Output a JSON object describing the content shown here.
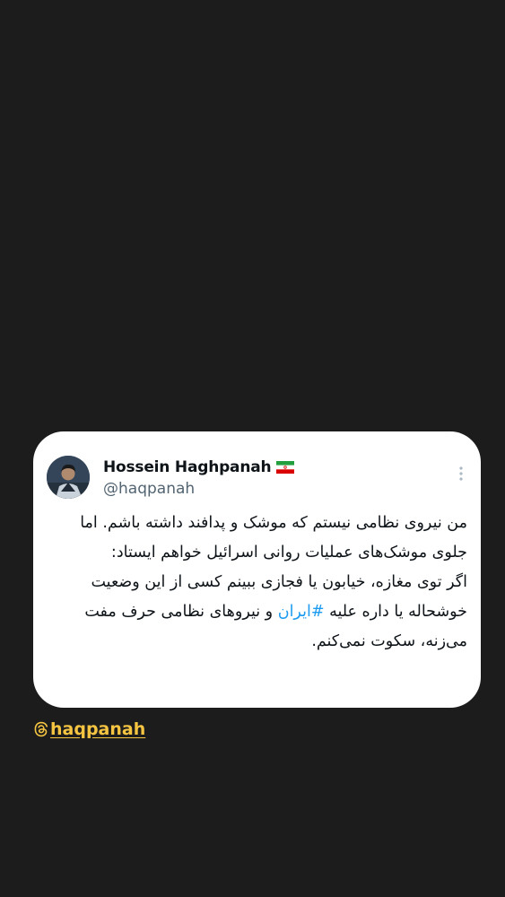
{
  "tweet": {
    "author_name": "Hossein Haghpanah",
    "author_handle": "@haqpanah",
    "lines": [
      "من نیروی نظامی نیستم که موشک و پدافند داشته باشم.",
      "اما جلوی موشک‌های عملیات روانی اسرائیل خواهم ایستاد:",
      "اگر توی مغازه، خیابون یا فجازی ببینم کسی از این وضعیت خوشحاله یا داره علیه",
      "و نیروهای نظامی حرف مفت می‌زنه، سکوت نمی‌کنم."
    ],
    "hashtag": "#ایران"
  },
  "credit": {
    "icon": "threads-icon",
    "handle": "haqpanah"
  },
  "colors": {
    "background": "#1c1c1c",
    "card": "#ffffff",
    "hashtag": "#1d9bf0",
    "credit": "#f5c542"
  }
}
